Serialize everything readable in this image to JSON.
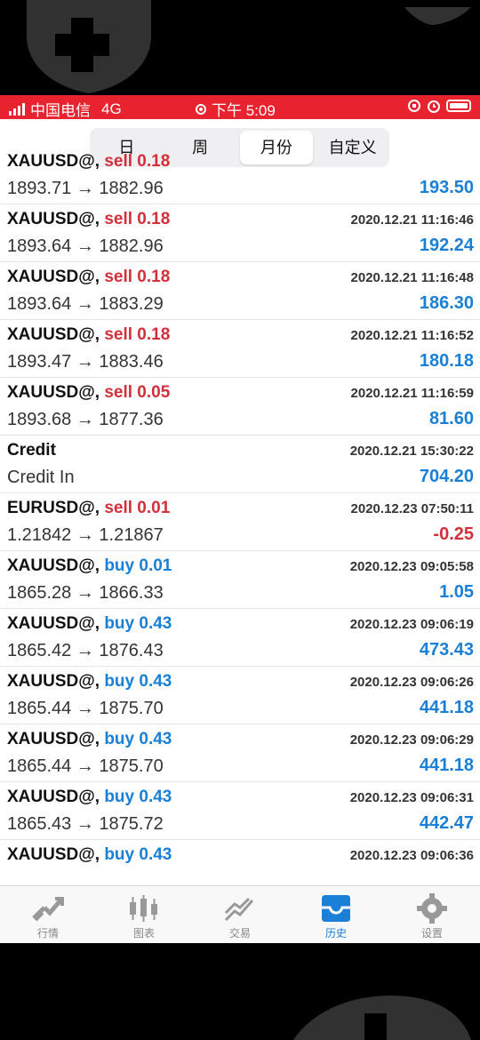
{
  "status": {
    "carrier": "中国电信",
    "network": "4G",
    "time": "下午 5:09"
  },
  "segments": [
    {
      "label": "日",
      "active": false
    },
    {
      "label": "周",
      "active": false
    },
    {
      "label": "月份",
      "active": true
    },
    {
      "label": "自定义",
      "active": false
    }
  ],
  "trades": [
    {
      "symbol": "XAUUSD@,",
      "action": "sell 0.18",
      "side": "sell",
      "time": "",
      "prices": "1893.71 → 1882.96",
      "profit": "193.50"
    },
    {
      "symbol": "XAUUSD@,",
      "action": "sell 0.18",
      "side": "sell",
      "time": "2020.12.21 11:16:46",
      "prices": "1893.64 → 1882.96",
      "profit": "192.24"
    },
    {
      "symbol": "XAUUSD@,",
      "action": "sell 0.18",
      "side": "sell",
      "time": "2020.12.21 11:16:48",
      "prices": "1893.64 → 1883.29",
      "profit": "186.30"
    },
    {
      "symbol": "XAUUSD@,",
      "action": "sell 0.18",
      "side": "sell",
      "time": "2020.12.21 11:16:52",
      "prices": "1893.47 → 1883.46",
      "profit": "180.18"
    },
    {
      "symbol": "XAUUSD@,",
      "action": "sell 0.05",
      "side": "sell",
      "time": "2020.12.21 11:16:59",
      "prices": "1893.68 → 1877.36",
      "profit": "81.60"
    },
    {
      "symbol": "Credit",
      "action": "",
      "side": "",
      "time": "2020.12.21 15:30:22",
      "prices": "Credit In",
      "profit": "704.20"
    },
    {
      "symbol": "EURUSD@,",
      "action": "sell 0.01",
      "side": "sell",
      "time": "2020.12.23 07:50:11",
      "prices": "1.21842 → 1.21867",
      "profit": "-0.25"
    },
    {
      "symbol": "XAUUSD@,",
      "action": "buy 0.01",
      "side": "buy",
      "time": "2020.12.23 09:05:58",
      "prices": "1865.28 → 1866.33",
      "profit": "1.05"
    },
    {
      "symbol": "XAUUSD@,",
      "action": "buy 0.43",
      "side": "buy",
      "time": "2020.12.23 09:06:19",
      "prices": "1865.42 → 1876.43",
      "profit": "473.43"
    },
    {
      "symbol": "XAUUSD@,",
      "action": "buy 0.43",
      "side": "buy",
      "time": "2020.12.23 09:06:26",
      "prices": "1865.44 → 1875.70",
      "profit": "441.18"
    },
    {
      "symbol": "XAUUSD@,",
      "action": "buy 0.43",
      "side": "buy",
      "time": "2020.12.23 09:06:29",
      "prices": "1865.44 → 1875.70",
      "profit": "441.18"
    },
    {
      "symbol": "XAUUSD@,",
      "action": "buy 0.43",
      "side": "buy",
      "time": "2020.12.23 09:06:31",
      "prices": "1865.43 → 1875.72",
      "profit": "442.47"
    },
    {
      "symbol": "XAUUSD@,",
      "action": "buy 0.43",
      "side": "buy",
      "time": "2020.12.23 09:06:36",
      "prices": "",
      "profit": ""
    }
  ],
  "tabs": [
    {
      "label": "行情",
      "icon": "quotes-icon",
      "active": false
    },
    {
      "label": "图表",
      "icon": "chart-icon",
      "active": false
    },
    {
      "label": "交易",
      "icon": "trade-icon",
      "active": false
    },
    {
      "label": "历史",
      "icon": "history-icon",
      "active": true
    },
    {
      "label": "设置",
      "icon": "settings-icon",
      "active": false
    }
  ],
  "colors": {
    "statusbar": "#e8232f",
    "sell": "#d32f3a",
    "buy": "#1a7fd6",
    "profit_positive": "#1a7fd6",
    "profit_negative": "#d32f3a"
  }
}
